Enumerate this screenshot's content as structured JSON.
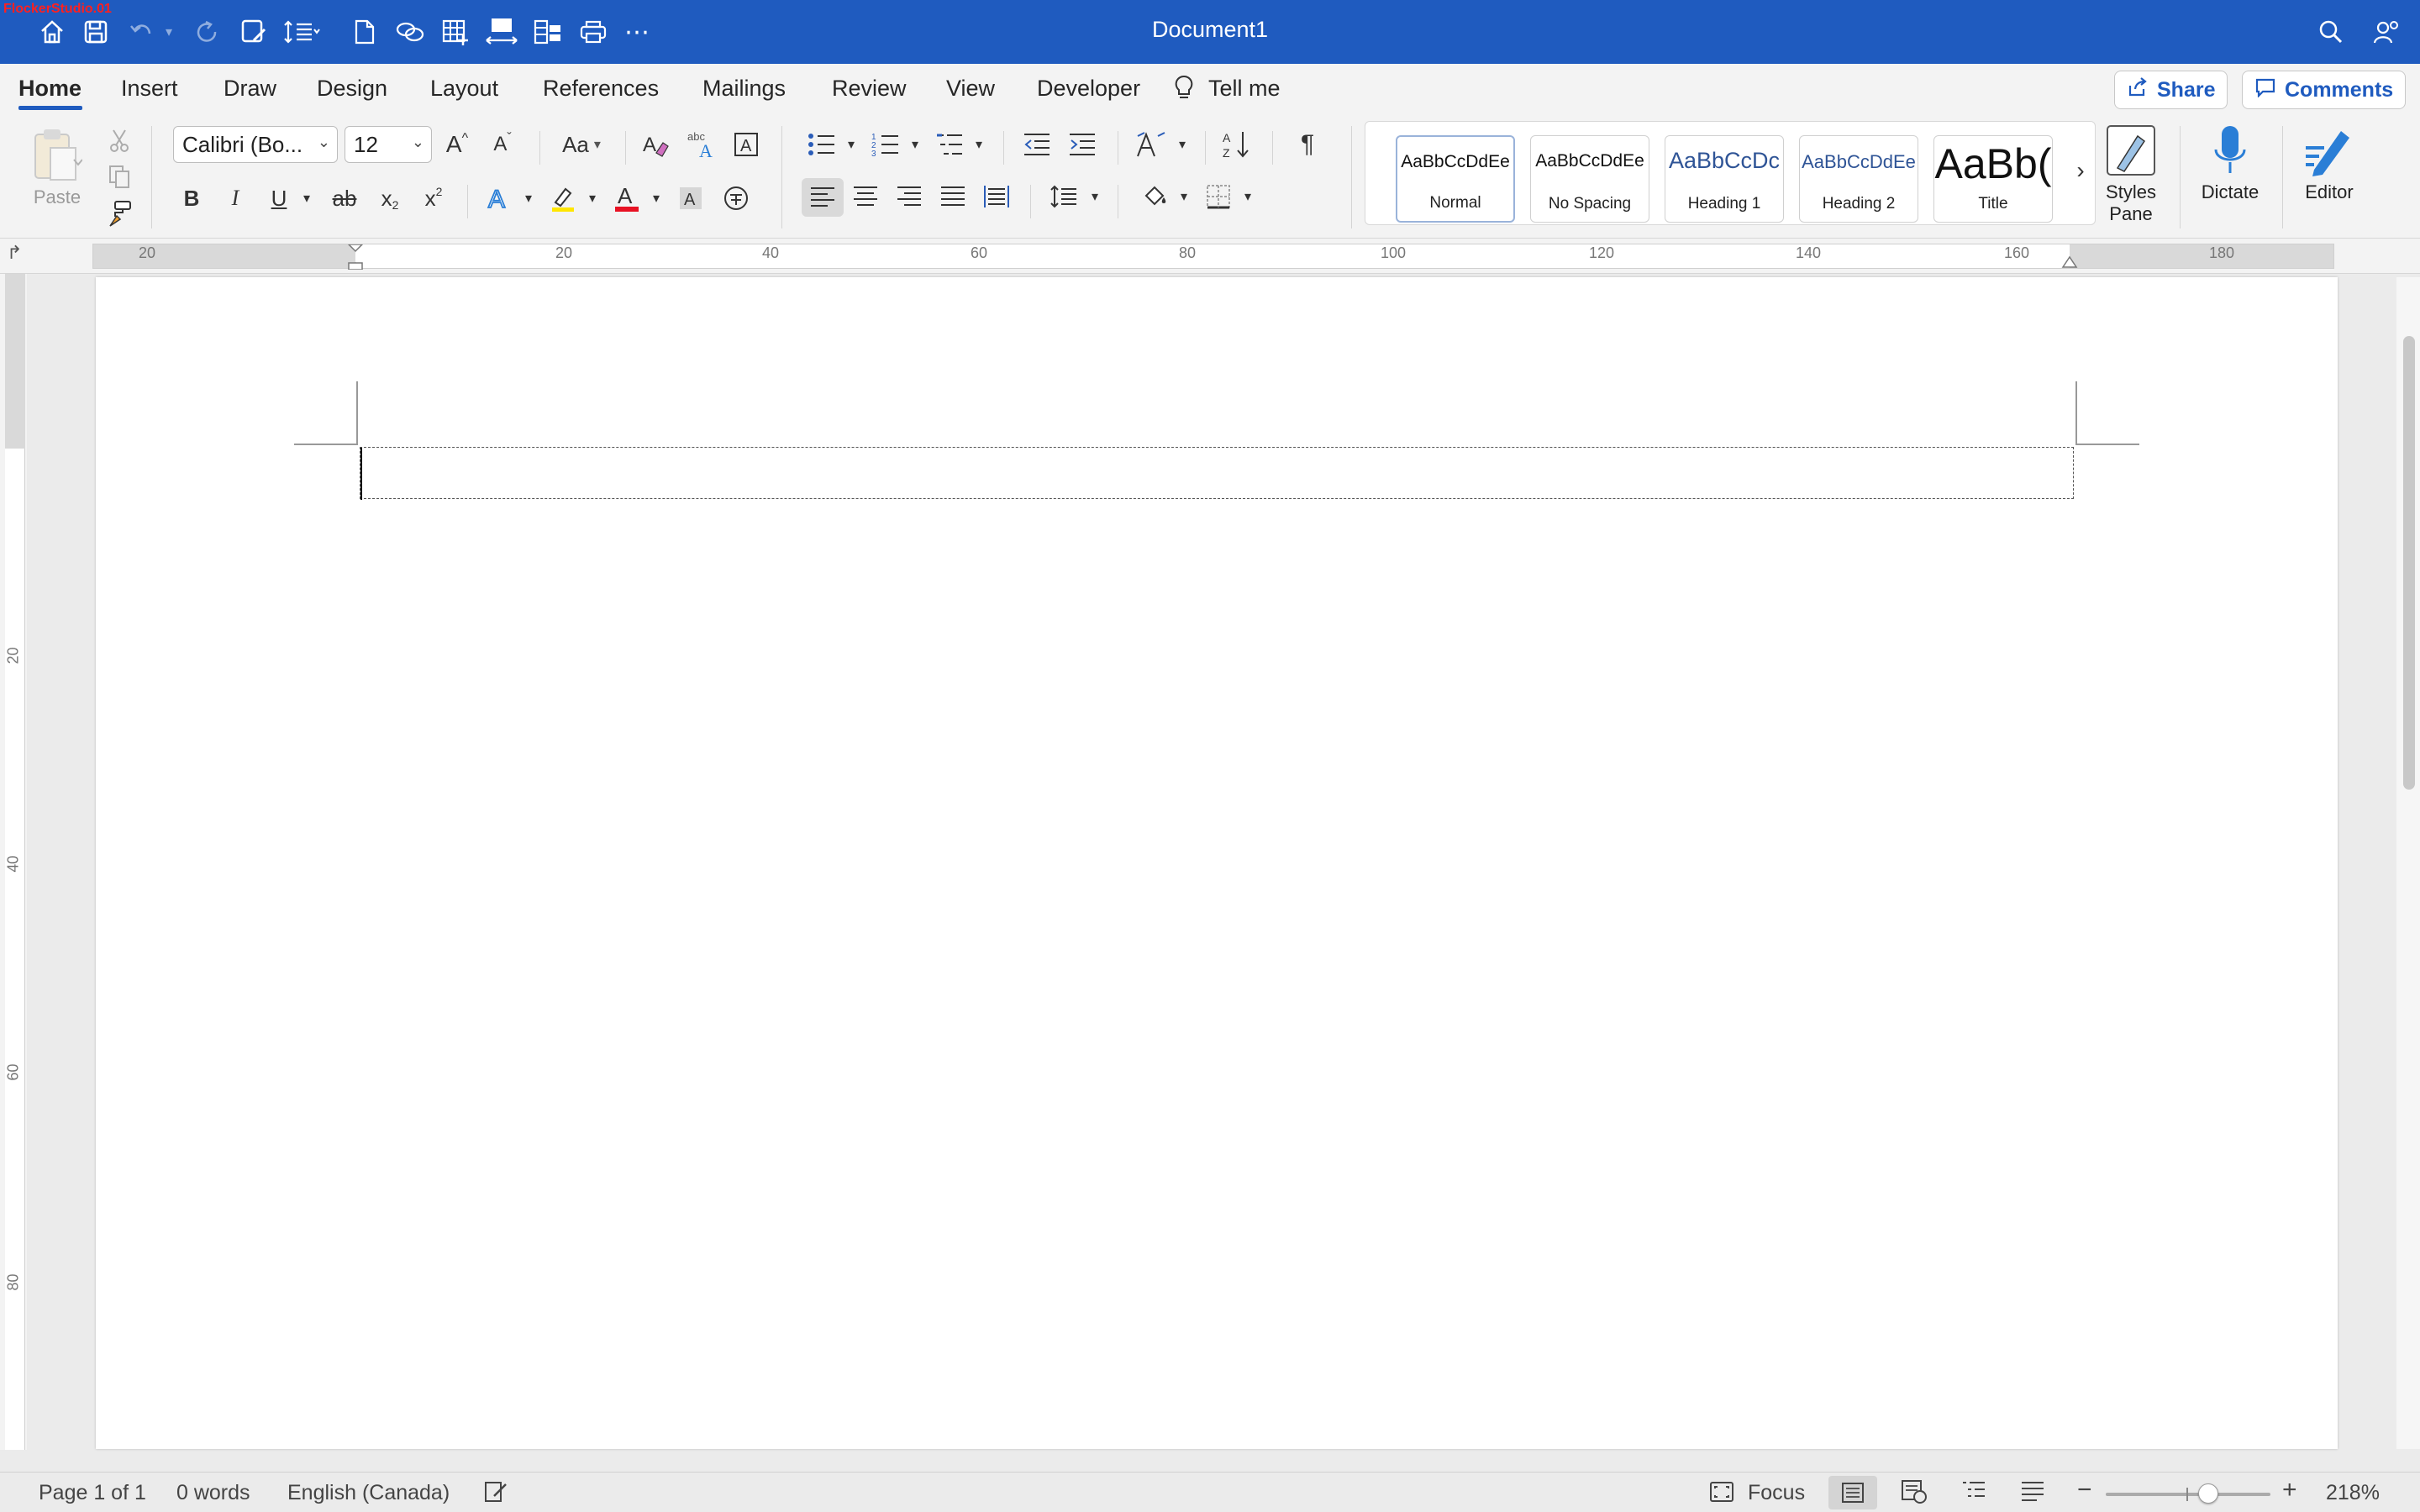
{
  "watermark": "FlockerStudio.01",
  "titlebar": {
    "title": "Document1"
  },
  "tabs": [
    {
      "label": "Home"
    },
    {
      "label": "Insert"
    },
    {
      "label": "Draw"
    },
    {
      "label": "Design"
    },
    {
      "label": "Layout"
    },
    {
      "label": "References"
    },
    {
      "label": "Mailings"
    },
    {
      "label": "Review"
    },
    {
      "label": "View"
    },
    {
      "label": "Developer"
    }
  ],
  "tell_me": "Tell me",
  "share": "Share",
  "comments": "Comments",
  "ribbon": {
    "paste": "Paste",
    "font_name": "Calibri (Bo...",
    "font_size": "12",
    "case_label": "Aa",
    "bold": "B",
    "italic": "I",
    "underline": "U",
    "strike": "ab",
    "subscript": "x",
    "superscript": "x",
    "pilcrow": "¶",
    "styles": [
      {
        "preview": "AaBbCcDdEe",
        "name": "Normal"
      },
      {
        "preview": "AaBbCcDdEe",
        "name": "No Spacing"
      },
      {
        "preview": "AaBbCcDc",
        "name": "Heading 1"
      },
      {
        "preview": "AaBbCcDdEe",
        "name": "Heading 2"
      },
      {
        "preview": "AaBb(",
        "name": "Title"
      }
    ],
    "styles_pane": "Styles Pane",
    "dictate": "Dictate",
    "editor": "Editor"
  },
  "ruler_h": [
    "20",
    "20",
    "40",
    "60",
    "80",
    "100",
    "120",
    "140",
    "160",
    "180"
  ],
  "ruler_v": [
    "20",
    "40",
    "60",
    "80"
  ],
  "status": {
    "page": "Page 1 of 1",
    "words": "0 words",
    "language": "English (Canada)",
    "focus": "Focus",
    "zoom": "218%"
  },
  "zoom_level": 0.62,
  "colors": {
    "accent": "#1f5bbf",
    "highlight": "#ffe600",
    "font_color": "#e81123"
  }
}
